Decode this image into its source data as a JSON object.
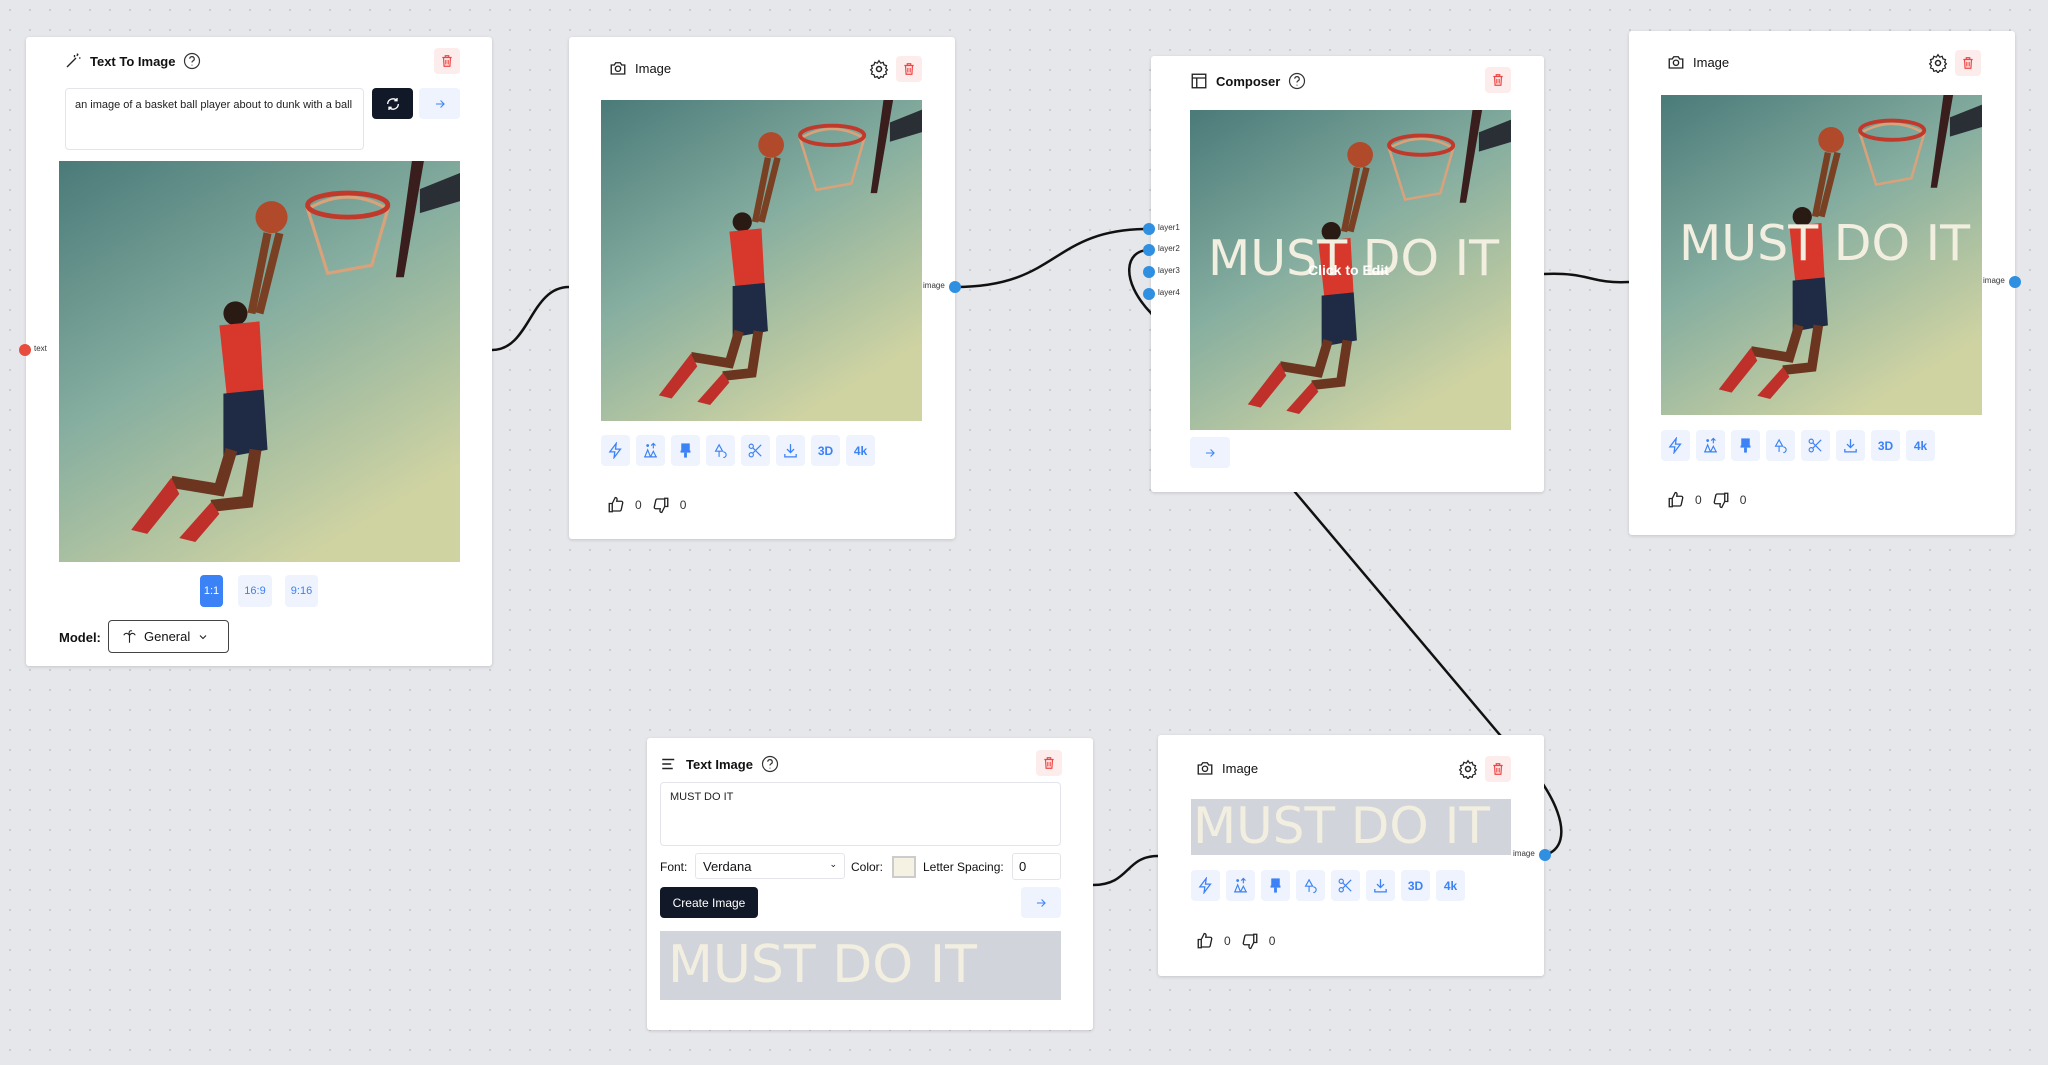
{
  "colors": {
    "accent": "#3b82f6",
    "dark_button": "#111827",
    "delete": "#ef4444",
    "handle": "#2f8fe0",
    "text_handle": "#e74c3c",
    "text_color_swatch": "#f5f2e4"
  },
  "text_to_image": {
    "title": "Text To Image",
    "prompt": "an image of a basket ball player about to dunk with a ball",
    "aspect_ratios": [
      "1:1",
      "16:9",
      "9:16"
    ],
    "selected_aspect": "1:1",
    "model_label": "Model:",
    "model_value": "General",
    "handle_text": "text"
  },
  "image_node_1": {
    "title": "Image",
    "handle": "image",
    "likes": "0",
    "dislikes": "0"
  },
  "composer": {
    "title": "Composer",
    "layers": [
      "layer1",
      "layer2",
      "layer3",
      "layer4"
    ],
    "overlay_text": "MUST DO IT",
    "click_to_edit": "Click to Edit"
  },
  "image_node_2": {
    "title": "Image",
    "handle": "image",
    "overlay_text": "MUST DO IT",
    "likes": "0",
    "dislikes": "0"
  },
  "text_image": {
    "title": "Text Image",
    "text": "MUST DO IT",
    "font_label": "Font:",
    "font_value": "Verdana",
    "color_label": "Color:",
    "letter_spacing_label": "Letter Spacing:",
    "letter_spacing_value": "0",
    "create_label": "Create Image",
    "preview_text": "MUST DO IT"
  },
  "image_node_3": {
    "title": "Image",
    "handle": "image",
    "preview_text": "MUST DO IT",
    "likes": "0",
    "dislikes": "0"
  },
  "toolbar": {
    "labels": {
      "three_d": "3D",
      "four_k": "4k"
    },
    "icons": [
      "bolt-icon",
      "upscale-people-icon",
      "brush-icon",
      "shapes-icon",
      "scissors-icon",
      "download-icon"
    ]
  }
}
